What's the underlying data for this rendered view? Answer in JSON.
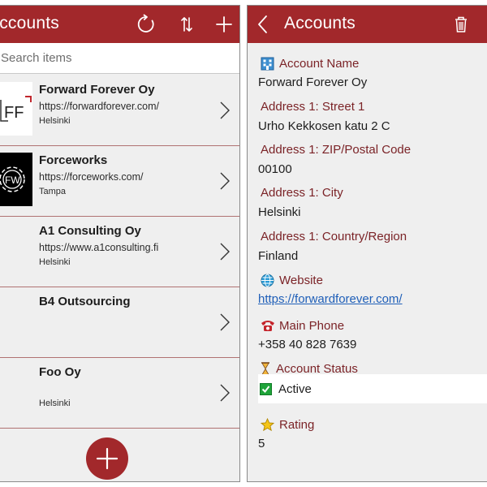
{
  "list_screen": {
    "title": "Accounts",
    "icons": {
      "refresh": "refresh-icon",
      "sort": "sort-icon",
      "add": "plus-icon"
    },
    "search": {
      "placeholder": "Search items",
      "value": ""
    },
    "items": [
      {
        "name": "Forward Forever Oy",
        "url": "https://forwardforever.com/",
        "city": "Helsinki",
        "logo_text": "FF"
      },
      {
        "name": "Forceworks",
        "url": "https://forceworks.com/",
        "city": "Tampa",
        "logo_text": "FW"
      },
      {
        "name": "A1 Consulting Oy",
        "url": "https://www.a1consulting.fi",
        "city": "Helsinki"
      },
      {
        "name": "B4 Outsourcing",
        "url": "",
        "city": ""
      },
      {
        "name": "Foo Oy",
        "url": "",
        "city": "Helsinki"
      }
    ],
    "fab_icon": "plus-icon"
  },
  "detail_screen": {
    "title": "Accounts",
    "icons": {
      "back": "chevron-left-icon",
      "delete": "trash-icon"
    },
    "fields": {
      "account_name": {
        "label": "Account Name",
        "value": "Forward Forever Oy",
        "icon": "building-icon"
      },
      "street": {
        "label": "Address 1: Street 1",
        "value": "Urho Kekkosen katu 2 C"
      },
      "zip": {
        "label": "Address 1: ZIP/Postal Code",
        "value": "00100"
      },
      "city": {
        "label": "Address 1: City",
        "value": "Helsinki"
      },
      "country": {
        "label": "Address 1: Country/Region",
        "value": "Finland"
      },
      "website": {
        "label": "Website",
        "value": "https://forwardforever.com/",
        "icon": "globe-icon"
      },
      "phone": {
        "label": "Main Phone",
        "value": "+358 40 828 7639",
        "icon": "telephone-icon"
      },
      "status": {
        "label": "Account Status",
        "value": "Active",
        "icon": "hourglass-icon",
        "check_icon": "checkmark-icon"
      },
      "rating": {
        "label": "Rating",
        "value": "5",
        "icon": "star-icon"
      }
    }
  },
  "colors": {
    "brand": "#a2282b",
    "label": "#7b2327",
    "link": "#1f5fb8",
    "panel_bg": "#efefef",
    "check": "#1fa43a"
  }
}
